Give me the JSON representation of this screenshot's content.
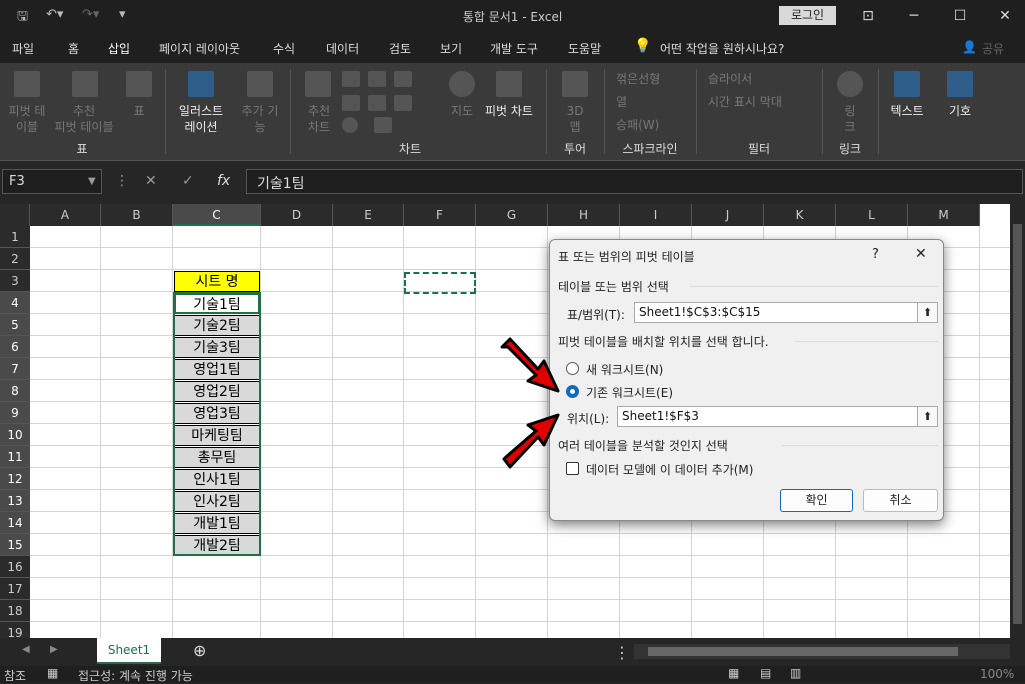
{
  "titlebar": {
    "title": "통합 문서1  -  Excel",
    "login": "로그인",
    "minimize": "─",
    "restore": "☐",
    "close": "✕",
    "ribbon_display": "⊡"
  },
  "menu": [
    "파일",
    "홈",
    "삽입",
    "페이지 레이아웃",
    "수식",
    "데이터",
    "검토",
    "보기",
    "개발 도구",
    "도움말"
  ],
  "menu_search": "어떤 작업을 원하시나요?",
  "share": "공유",
  "ribbon": {
    "pivot_table": "피벗 테\n이블",
    "recommended_pivot": "추천\n피벗 테이블",
    "table": "표",
    "illustrations": "일러스트\n레이션",
    "addins": "추가 기\n능",
    "recommended_charts": "추천\n차트",
    "maps": "지도",
    "pivot_chart": "피벗 차트",
    "map3d": "3D\n맵",
    "spark_line": "꺾은선형",
    "spark_column": "열",
    "spark_winloss": "승패(W)",
    "slicer": "슬라이서",
    "timeline": "시간 표시 막대",
    "link": "링\n크",
    "text": "텍스트",
    "symbol": "기호",
    "groups": {
      "table": "표",
      "chart": "차트",
      "tour": "투어",
      "sparkline": "스파크라인",
      "filter": "필터",
      "link": "링크"
    }
  },
  "formula_bar": {
    "namebox": "F3",
    "fx": "fx",
    "value": "기술1팀"
  },
  "columns": [
    "A",
    "B",
    "C",
    "D",
    "E",
    "F",
    "G",
    "H",
    "I",
    "J",
    "K",
    "L",
    "M"
  ],
  "rows": [
    "1",
    "2",
    "3",
    "4",
    "5",
    "6",
    "7",
    "8",
    "9",
    "10",
    "11",
    "12",
    "13",
    "14",
    "15",
    "16",
    "17",
    "18",
    "19"
  ],
  "sheet": {
    "header": "시트 명",
    "cells": [
      "기술1팀",
      "기술2팀",
      "기술3팀",
      "영업1팀",
      "영업2팀",
      "영업3팀",
      "마케팅팀",
      "총무팀",
      "인사1팀",
      "인사2팀",
      "개발1팀",
      "개발2팀"
    ],
    "header_color": "#ffff00",
    "cell_color": "#d9d9d9"
  },
  "sheet_tab": "Sheet1",
  "status": {
    "ready": "참조",
    "accessibility": "접근성: 계속 진행 가능",
    "zoom": "100%"
  },
  "dialog": {
    "title": "표 또는 범위의 피벗 테이블",
    "help": "?",
    "close": "✕",
    "section1": "테이블 또는 범위 선택",
    "range_label": "표/범위(T):",
    "range_value": "Sheet1!$C$3:$C$15",
    "section2": "피벗 테이블을 배치할 위치를 선택 합니다.",
    "new_ws": "새 워크시트(N)",
    "existing_ws": "기존 워크시트(E)",
    "location_label": "위치(L):",
    "location_value": "Sheet1!$F$3",
    "section3": "여러 테이블을 분석할 것인지 선택",
    "datamodel": "데이터 모델에 이 데이터 추가(M)",
    "ok": "확인",
    "cancel": "취소"
  }
}
